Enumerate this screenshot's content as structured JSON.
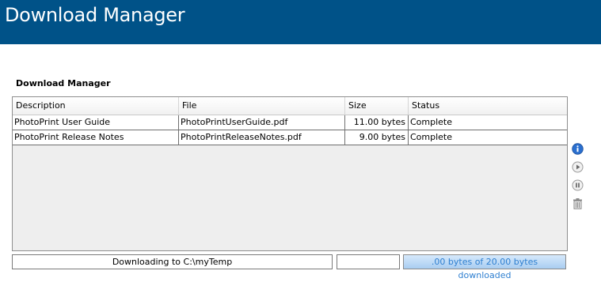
{
  "banner": {
    "title": "Download Manager"
  },
  "panel": {
    "title": "Download Manager"
  },
  "table": {
    "columns": [
      "Description",
      "File",
      "Size",
      "Status"
    ],
    "rows": [
      {
        "description": "PhotoPrint User Guide",
        "file": "PhotoPrintUserGuide.pdf",
        "size": "11.00 bytes",
        "status": "Complete"
      },
      {
        "description": "PhotoPrint Release Notes",
        "file": "PhotoPrintReleaseNotes.pdf",
        "size": "9.00 bytes",
        "status": "Complete"
      }
    ]
  },
  "side_toolbar": {
    "icons": [
      "info-icon",
      "play-icon",
      "pause-icon",
      "trash-icon"
    ]
  },
  "footer": {
    "status_text": "Downloading to C:\\myTemp",
    "secondary_text": "",
    "progress_text": ".00 bytes of 20.00 bytes downloaded",
    "progress_fraction": 1.0
  },
  "colors": {
    "banner": "#005288",
    "info_icon": "#2a6fcf",
    "progress_text": "#2e7fd0"
  }
}
